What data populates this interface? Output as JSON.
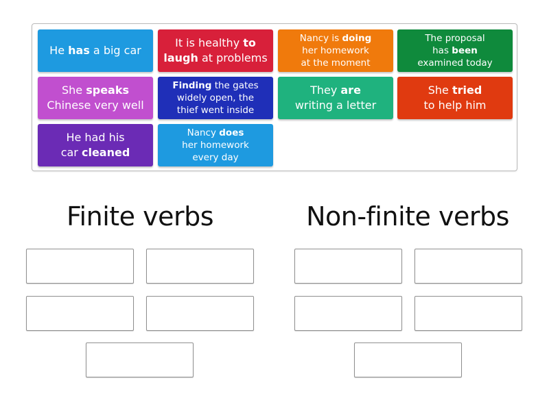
{
  "cards": [
    {
      "parts": [
        {
          "t": "He ",
          "b": false
        },
        {
          "t": "has",
          "b": true
        },
        {
          "t": " a big car",
          "b": false
        }
      ],
      "color": "#1e9ae0"
    },
    {
      "parts": [
        {
          "t": "It is healthy ",
          "b": false
        },
        {
          "t": "to\nlaugh",
          "b": true
        },
        {
          "t": " at problems",
          "b": false
        }
      ],
      "color": "#d8203a"
    },
    {
      "parts": [
        {
          "t": "Nancy is ",
          "b": false
        },
        {
          "t": "doing",
          "b": true
        },
        {
          "t": "\nher homework\nat the moment",
          "b": false
        }
      ],
      "color": "#f07a0c"
    },
    {
      "parts": [
        {
          "t": "The proposal\nhas ",
          "b": false
        },
        {
          "t": "been",
          "b": true
        },
        {
          "t": "\nexamined today",
          "b": false
        }
      ],
      "color": "#0f8a3c"
    },
    {
      "parts": [
        {
          "t": "She ",
          "b": false
        },
        {
          "t": "speaks",
          "b": true
        },
        {
          "t": "\nChinese very well",
          "b": false
        }
      ],
      "color": "#c14fcf"
    },
    {
      "parts": [
        {
          "t": "Finding",
          "b": true
        },
        {
          "t": " the gates\nwidely open, the\nthief went inside",
          "b": false
        }
      ],
      "color": "#1f2fb8"
    },
    {
      "parts": [
        {
          "t": "They ",
          "b": false
        },
        {
          "t": "are",
          "b": true
        },
        {
          "t": "\nwriting a letter",
          "b": false
        }
      ],
      "color": "#1fb27e"
    },
    {
      "parts": [
        {
          "t": "She ",
          "b": false
        },
        {
          "t": "tried",
          "b": true
        },
        {
          "t": "\nto help him",
          "b": false
        }
      ],
      "color": "#e03a10"
    },
    {
      "parts": [
        {
          "t": "He had his\ncar ",
          "b": false
        },
        {
          "t": "cleaned",
          "b": true
        }
      ],
      "color": "#6b2bb5"
    },
    {
      "parts": [
        {
          "t": "Nancy ",
          "b": false
        },
        {
          "t": "does",
          "b": true
        },
        {
          "t": "\nher homework\nevery day",
          "b": false
        }
      ],
      "color": "#1e9ae0"
    }
  ],
  "groups": [
    {
      "title": "Finite verbs",
      "slot_count": 5
    },
    {
      "title": "Non-finite verbs",
      "slot_count": 5
    }
  ]
}
